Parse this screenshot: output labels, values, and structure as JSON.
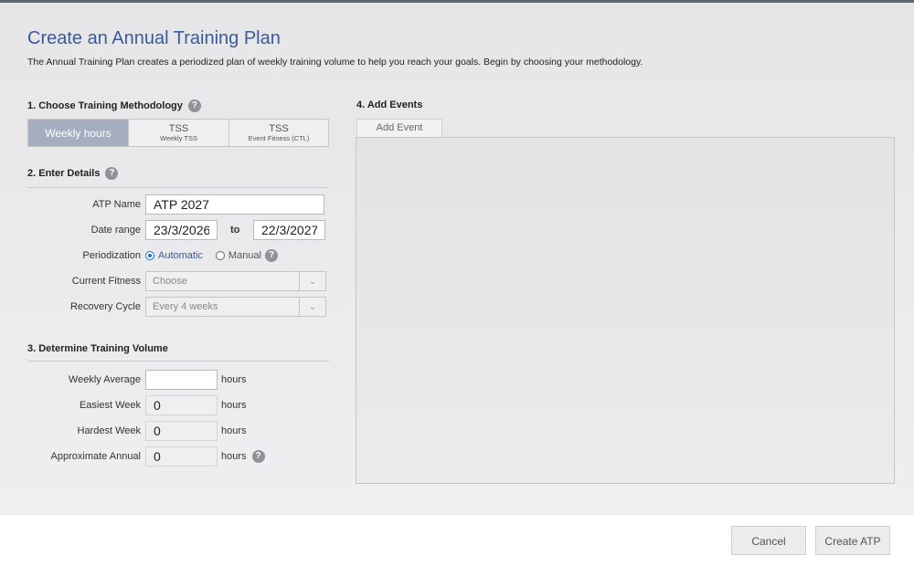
{
  "header": {
    "title": "Create an Annual Training Plan",
    "subtitle": "The Annual Training Plan creates a periodized plan of weekly training volume to help you reach your goals. Begin by choosing your methodology."
  },
  "methodology": {
    "heading": "1. Choose Training Methodology",
    "help": "?",
    "options": [
      {
        "label": "Weekly hours",
        "sub": "",
        "active": true
      },
      {
        "label": "TSS",
        "sub": "Weekly TSS",
        "active": false
      },
      {
        "label": "TSS",
        "sub": "Event Fitness (CTL)",
        "active": false
      }
    ]
  },
  "details": {
    "heading": "2. Enter Details",
    "help": "?",
    "atp_name_label": "ATP Name",
    "atp_name_value": "ATP 2027",
    "date_range_label": "Date range",
    "date_start": "23/3/2026",
    "to_label": "to",
    "date_end": "22/3/2027",
    "periodization_label": "Periodization",
    "periodization_automatic": "Automatic",
    "periodization_manual": "Manual",
    "periodization_selected": "Automatic",
    "current_fitness_label": "Current Fitness",
    "current_fitness_value": "Choose",
    "recovery_cycle_label": "Recovery Cycle",
    "recovery_cycle_value": "Every 4 weeks"
  },
  "volume": {
    "heading": "3. Determine Training Volume",
    "weekly_average_label": "Weekly Average",
    "weekly_average_value": "",
    "easiest_week_label": "Easiest Week",
    "easiest_week_value": "0",
    "hardest_week_label": "Hardest Week",
    "hardest_week_value": "0",
    "approx_annual_label": "Approximate Annual",
    "approx_annual_value": "0",
    "unit": "hours",
    "help": "?"
  },
  "events": {
    "heading": "4. Add Events",
    "add_event_label": "Add Event"
  },
  "footer": {
    "cancel_label": "Cancel",
    "create_label": "Create ATP"
  },
  "colors": {
    "title": "#3a5a9c",
    "active_segment": "#a5aec1",
    "radio_accent": "#1a6be0"
  }
}
